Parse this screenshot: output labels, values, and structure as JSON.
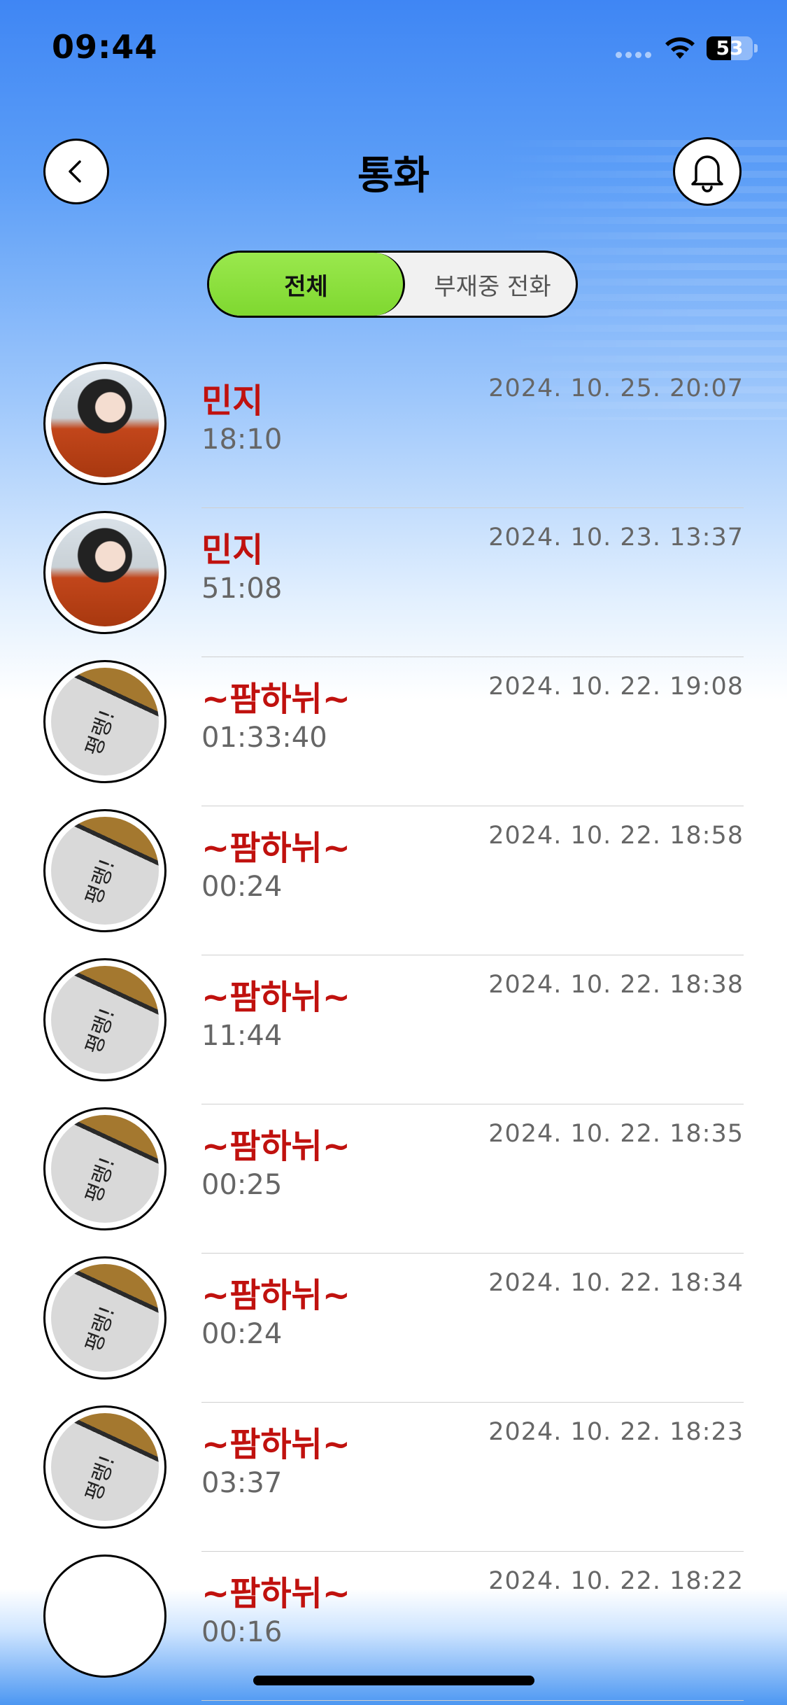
{
  "status_bar": {
    "time": "09:44",
    "battery_level": 53,
    "battery_label": "53"
  },
  "header": {
    "title": "통화"
  },
  "tabs": [
    {
      "label": "전체",
      "selected": true
    },
    {
      "label": "부재중 전화",
      "selected": false
    }
  ],
  "colors": {
    "name": "#c0110e",
    "selected_tab": "#8ee03c",
    "header_blue": "#3f86f4"
  },
  "calls": [
    {
      "name": "민지",
      "duration": "18:10",
      "date": "2024. 10. 25. 20:07",
      "photo": "person"
    },
    {
      "name": "민지",
      "duration": "51:08",
      "date": "2024. 10. 23. 13:37",
      "photo": "person"
    },
    {
      "name": "~팜하뉘~",
      "duration": "01:33:40",
      "date": "2024. 10. 22. 19:08",
      "photo": "note"
    },
    {
      "name": "~팜하뉘~",
      "duration": "00:24",
      "date": "2024. 10. 22. 18:58",
      "photo": "note"
    },
    {
      "name": "~팜하뉘~",
      "duration": "11:44",
      "date": "2024. 10. 22. 18:38",
      "photo": "note"
    },
    {
      "name": "~팜하뉘~",
      "duration": "00:25",
      "date": "2024. 10. 22. 18:35",
      "photo": "note"
    },
    {
      "name": "~팜하뉘~",
      "duration": "00:24",
      "date": "2024. 10. 22. 18:34",
      "photo": "note"
    },
    {
      "name": "~팜하뉘~",
      "duration": "03:37",
      "date": "2024. 10. 22. 18:23",
      "photo": "note"
    },
    {
      "name": "~팜하뉘~",
      "duration": "00:16",
      "date": "2024. 10. 22. 18:22",
      "photo": "empty"
    }
  ]
}
